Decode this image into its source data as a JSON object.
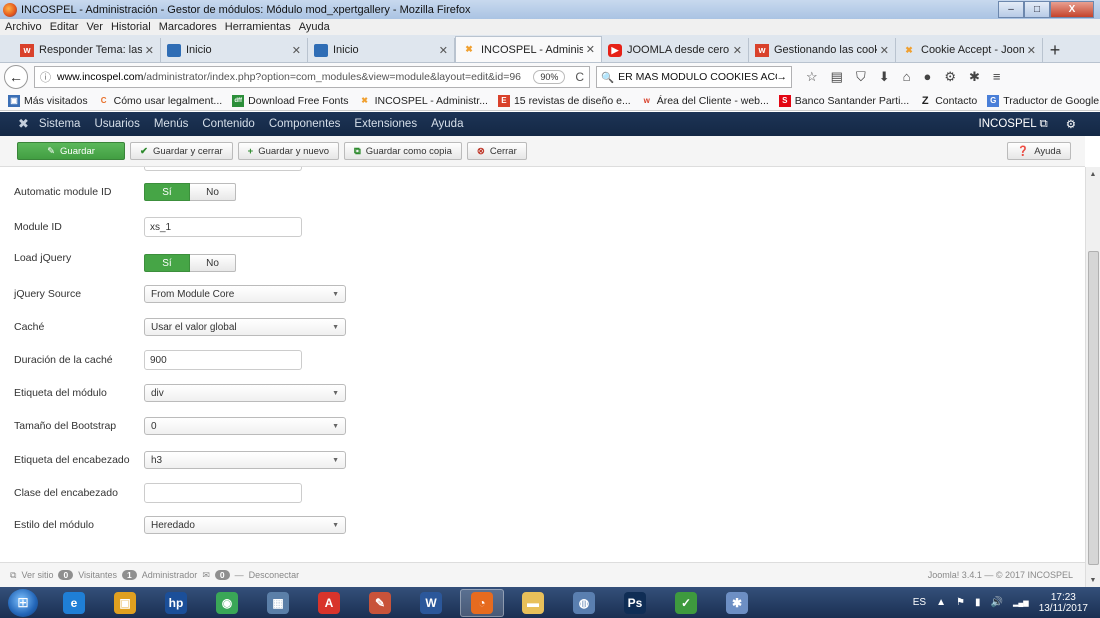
{
  "window": {
    "title": "INCOSPEL - Administración - Gestor de módulos: Módulo mod_xpertgallery - Mozilla Firefox",
    "minimize": "–",
    "maximize": "□",
    "close": "X"
  },
  "menubar": [
    "Archivo",
    "Editar",
    "Ver",
    "Historial",
    "Marcadores",
    "Herramientas",
    "Ayuda"
  ],
  "tabs": [
    {
      "label": "Responder Tema: las im",
      "icon_text": "w",
      "icon_color": "#d9412b",
      "active": false
    },
    {
      "label": "Inicio",
      "icon_text": "",
      "icon_color": "#2f6db5",
      "active": false
    },
    {
      "label": "Inicio",
      "icon_text": "",
      "icon_color": "#2f6db5",
      "active": false
    },
    {
      "label": "INCOSPEL - Administrac",
      "icon_text": "✖",
      "icon_color": "#f0a030",
      "active": true
    },
    {
      "label": "JOOMLA desde cero - Tu",
      "icon_text": "▶",
      "icon_color": "#e62117",
      "active": false
    },
    {
      "label": "Gestionando las cookies",
      "icon_text": "w",
      "icon_color": "#d9412b",
      "active": false
    },
    {
      "label": "Cookie Accept - Joomla!",
      "icon_text": "✖",
      "icon_color": "#f0a030",
      "active": false
    }
  ],
  "newtab": "+",
  "nav": {
    "back": "←",
    "info": "ⓘ",
    "url_domain": "www.incospel.com",
    "url_path": "/administrator/index.php?option=com_modules&view=module&layout=edit&id=96",
    "zoom": "90%",
    "reload": "C",
    "search_value": "ER MAS MODULO COOKIES ACCEPT",
    "search_go": "→",
    "tool_icons": [
      "☆",
      "▤",
      "⛉",
      "⬇",
      "⌂",
      "●",
      "⚙",
      "✱",
      "≡"
    ]
  },
  "bookmarks": [
    {
      "label": "Más visitados",
      "icon_text": "▣",
      "icon_color": "#3b6fb6"
    },
    {
      "label": "Cómo usar legalment...",
      "icon_text": "C",
      "icon_color": "#e8702a"
    },
    {
      "label": "Download Free Fonts",
      "icon_text": "dff",
      "icon_color": "#2c8f3a"
    },
    {
      "label": "INCOSPEL - Administr...",
      "icon_text": "✖",
      "icon_color": "#f0a030"
    },
    {
      "label": "15 revistas de diseño e...",
      "icon_text": "E",
      "icon_color": "#d9412b"
    },
    {
      "label": "Área del Cliente - web...",
      "icon_text": "w",
      "icon_color": "#d9412b"
    },
    {
      "label": "Banco Santander Parti...",
      "icon_text": "S",
      "icon_color": "#e30613"
    },
    {
      "label": "Contacto",
      "icon_text": "Z",
      "icon_color": "#222222"
    },
    {
      "label": "Traductor de Google",
      "icon_text": "G",
      "icon_color": "#4a7fd8"
    }
  ],
  "bookmarks_more": "»",
  "joomla_nav": {
    "logo": "✖",
    "items": [
      "Sistema",
      "Usuarios",
      "Menús",
      "Contenido",
      "Componentes",
      "Extensiones",
      "Ayuda"
    ],
    "site_name": "INCOSPEL ⧉",
    "gear": "⚙"
  },
  "toolbar": {
    "save": "Guardar",
    "save_close": "Guardar y cerrar",
    "save_new": "Guardar y nuevo",
    "save_copy": "Guardar como copia",
    "close": "Cerrar",
    "help": "Ayuda"
  },
  "form": {
    "auto_module_id": {
      "label": "Automatic module ID",
      "on": "Sí",
      "off": "No"
    },
    "module_id": {
      "label": "Module ID",
      "value": "xs_1"
    },
    "load_jquery": {
      "label": "Load jQuery",
      "on": "Sí",
      "off": "No"
    },
    "jquery_source": {
      "label": "jQuery Source",
      "value": "From Module Core"
    },
    "cache": {
      "label": "Caché",
      "value": "Usar el valor global"
    },
    "cache_duration": {
      "label": "Duración de la caché",
      "value": "900"
    },
    "module_tag": {
      "label": "Etiqueta del módulo",
      "value": "div"
    },
    "bootstrap_size": {
      "label": "Tamaño del Bootstrap",
      "value": "0"
    },
    "header_tag": {
      "label": "Etiqueta del encabezado",
      "value": "h3"
    },
    "header_class": {
      "label": "Clase del encabezado",
      "value": ""
    },
    "module_style": {
      "label": "Estilo del módulo",
      "value": "Heredado"
    }
  },
  "footer": {
    "view_site": "Ver sitio",
    "visitors_count": "0",
    "visitors_label": "Visitantes",
    "admins_count": "1",
    "admins_label": "Administrador",
    "messages_count": "0",
    "logout": "Desconectar",
    "version": "Joomla! 3.4.1 — © 2017 INCOSPEL"
  },
  "taskbar": {
    "apps": [
      {
        "name": "ie",
        "glyph": "e",
        "color": "#1f7fd6",
        "active": false
      },
      {
        "name": "media",
        "glyph": "▣",
        "color": "#e0a020",
        "active": false
      },
      {
        "name": "hp",
        "glyph": "hp",
        "color": "#1b4f99",
        "active": false
      },
      {
        "name": "chrome",
        "glyph": "◉",
        "color": "#3aa757",
        "active": false
      },
      {
        "name": "calculator",
        "glyph": "▦",
        "color": "#5b7fa8",
        "active": false
      },
      {
        "name": "acrobat",
        "glyph": "A",
        "color": "#d8342b",
        "active": false
      },
      {
        "name": "drawing",
        "glyph": "✎",
        "color": "#c8533a",
        "active": false
      },
      {
        "name": "word",
        "glyph": "W",
        "color": "#2b579a",
        "active": false
      },
      {
        "name": "firefox",
        "glyph": "◔",
        "color": "#e66b1f",
        "active": true
      },
      {
        "name": "explorer",
        "glyph": "▬",
        "color": "#e8c05a",
        "active": false
      },
      {
        "name": "network",
        "glyph": "◍",
        "color": "#5a7fb0",
        "active": false
      },
      {
        "name": "photoshop",
        "glyph": "Ps",
        "color": "#0f2d55",
        "active": false
      },
      {
        "name": "sketch",
        "glyph": "✓",
        "color": "#3e9a3e",
        "active": false
      },
      {
        "name": "paint",
        "glyph": "✱",
        "color": "#6d8fc4",
        "active": false
      }
    ],
    "lang": "ES",
    "tray_icons": [
      "▲",
      "⚑",
      "▮",
      "🔊",
      "▂▄▆"
    ],
    "time": "17:23",
    "date": "13/11/2017"
  }
}
